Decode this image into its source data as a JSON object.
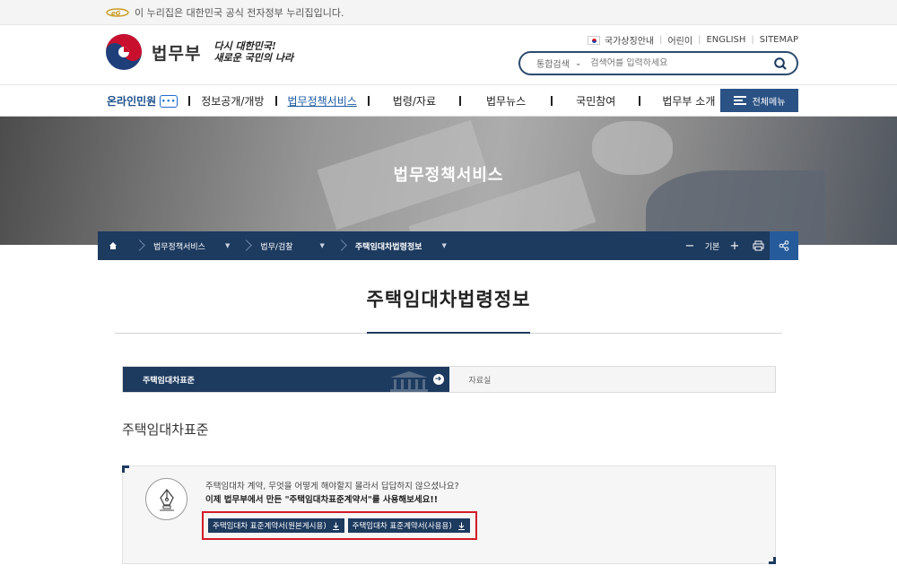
{
  "gov_banner": {
    "text": "이 누리집은 대한민국 공식 전자정부 누리집입니다."
  },
  "header": {
    "logo_text": "법무부",
    "slogan_line1": "다시 대한민국!",
    "slogan_line2": "새로운 국민의 나라",
    "util_links": [
      "국가상징안내",
      "어린이",
      "ENGLISH",
      "SITEMAP"
    ],
    "search": {
      "scope": "통합검색",
      "placeholder": "검색어를 입력하세요"
    }
  },
  "gnb": {
    "online": "온라인민원",
    "items": [
      "정보공개/개방",
      "법무정책서비스",
      "법령/자료",
      "법무뉴스",
      "국민참여",
      "법무부 소개"
    ],
    "all_menu": "전체메뉴"
  },
  "hero": {
    "title": "법무정책서비스"
  },
  "breadcrumb": {
    "items": [
      "법무정책서비스",
      "법무/검찰",
      "주택임대차법령정보"
    ],
    "zoom_label": "기본"
  },
  "page": {
    "title": "주택임대차법령정보"
  },
  "tabs": [
    "주택임대차표준",
    "자료실"
  ],
  "section": {
    "title": "주택임대차표준"
  },
  "info": {
    "line1": "주택임대차 계약, 무엇을 어떻게 해야할지 몰라서 답답하지 않으셨나요?",
    "line2": "이제 법무부에서 만든 \"주택임대차표준계약서\"를 사용해보세요!!",
    "buttons": [
      "주택임대차 표준계약서(원본게시용)",
      "주택임대차 표준계약서(사용용)"
    ]
  },
  "colors": {
    "navy": "#1d3a5f",
    "accent_blue": "#2b5285",
    "highlight_red": "#d11b2a"
  }
}
